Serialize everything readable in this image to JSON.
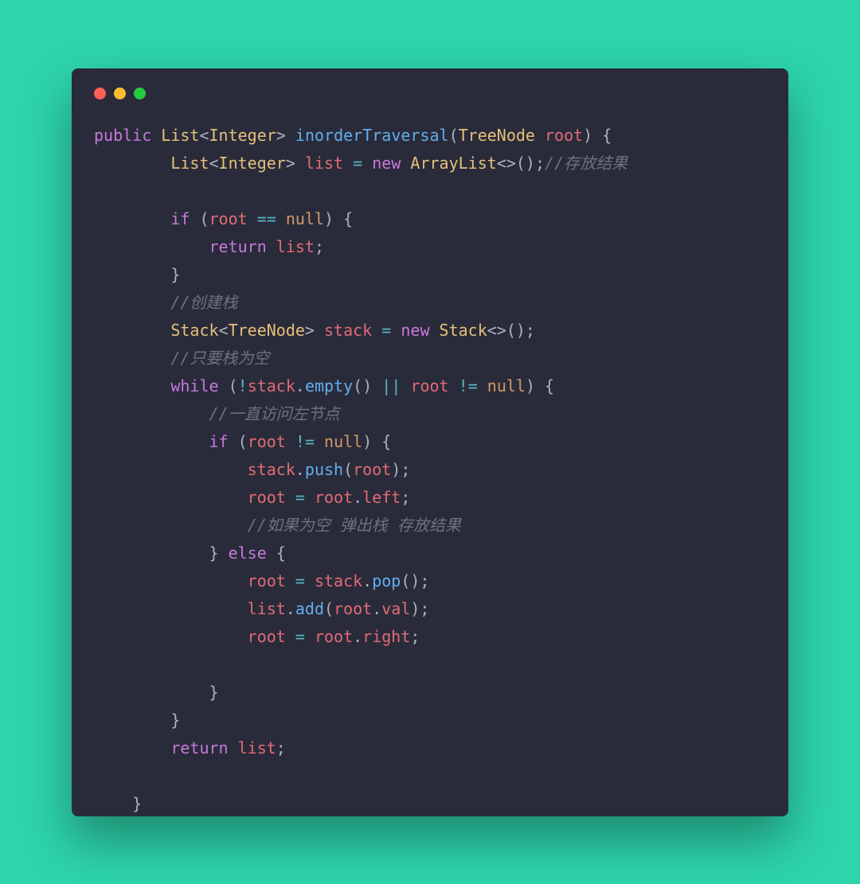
{
  "code": {
    "l1": {
      "kw_public": "public",
      "type_list": "List",
      "lt": "<",
      "type_int": "Integer",
      "gt": ">",
      "sp": " ",
      "fn": "inorderTraversal",
      "lp": "(",
      "ptype": "TreeNode",
      "pname": "root",
      "rp": ")",
      "lb": "{"
    },
    "l2": {
      "indent": "        ",
      "type_list": "List",
      "lt": "<",
      "type_int": "Integer",
      "gt": ">",
      "sp": " ",
      "var": "list",
      "eq": " = ",
      "kw_new": "new",
      "type_arr": "ArrayList",
      "lt2": "<>",
      "call": "();",
      "comment": "//存放结果"
    },
    "l3": {
      "indent": ""
    },
    "l4": {
      "indent": "        ",
      "kw_if": "if",
      "sp": " ",
      "lp": "(",
      "var": "root",
      "eq": " == ",
      "null": "null",
      "rp": ")",
      "lb": " {"
    },
    "l5": {
      "indent": "            ",
      "kw_return": "return",
      "sp": " ",
      "var": "list",
      "semi": ";"
    },
    "l6": {
      "indent": "        ",
      "rb": "}"
    },
    "l7": {
      "indent": "        ",
      "comment": "//创建栈"
    },
    "l8": {
      "indent": "        ",
      "type_stack": "Stack",
      "lt": "<",
      "type_tree": "TreeNode",
      "gt": ">",
      "sp": " ",
      "var": "stack",
      "eq": " = ",
      "kw_new": "new",
      "type_stack2": "Stack",
      "lt2": "<>",
      "call": "();"
    },
    "l9": {
      "indent": "        ",
      "comment": "//只要栈为空"
    },
    "l10": {
      "indent": "        ",
      "kw_while": "while",
      "sp": " ",
      "lp": "(",
      "neg": "!",
      "var_stack": "stack",
      "dot": ".",
      "fn_empty": "empty",
      "call": "()",
      "or": " || ",
      "var_root": "root",
      "neq": " != ",
      "null": "null",
      "rp": ")",
      "lb": " {"
    },
    "l11": {
      "indent": "            ",
      "comment": "//一直访问左节点"
    },
    "l12": {
      "indent": "            ",
      "kw_if": "if",
      "sp": " ",
      "lp": "(",
      "var": "root",
      "neq": " != ",
      "null": "null",
      "rp": ")",
      "lb": " {"
    },
    "l13": {
      "indent": "                ",
      "var_stack": "stack",
      "dot": ".",
      "fn_push": "push",
      "lp": "(",
      "arg": "root",
      "rp": ");"
    },
    "l14": {
      "indent": "                ",
      "var_root": "root",
      "eq": " = ",
      "var_root2": "root",
      "dot": ".",
      "prop": "left",
      "semi": ";"
    },
    "l15": {
      "indent": "                ",
      "comment": "//如果为空 弹出栈 存放结果"
    },
    "l16": {
      "indent": "            ",
      "rb": "}",
      "sp": " ",
      "kw_else": "else",
      "lb": " {"
    },
    "l17": {
      "indent": "                ",
      "var_root": "root",
      "eq": " = ",
      "var_stack": "stack",
      "dot": ".",
      "fn_pop": "pop",
      "call": "();"
    },
    "l18": {
      "indent": "                ",
      "var_list": "list",
      "dot": ".",
      "fn_add": "add",
      "lp": "(",
      "arg": "root",
      "dot2": ".",
      "prop": "val",
      "rp": ");"
    },
    "l19": {
      "indent": "                ",
      "var_root": "root",
      "eq": " = ",
      "var_root2": "root",
      "dot": ".",
      "prop": "right",
      "semi": ";"
    },
    "l20": {
      "indent": ""
    },
    "l21": {
      "indent": "            ",
      "rb": "}"
    },
    "l22": {
      "indent": "        ",
      "rb": "}"
    },
    "l23": {
      "indent": "        ",
      "kw_return": "return",
      "sp": " ",
      "var": "list",
      "semi": ";"
    },
    "l24": {
      "indent": ""
    },
    "l25": {
      "indent": "    ",
      "rb": "}"
    }
  }
}
